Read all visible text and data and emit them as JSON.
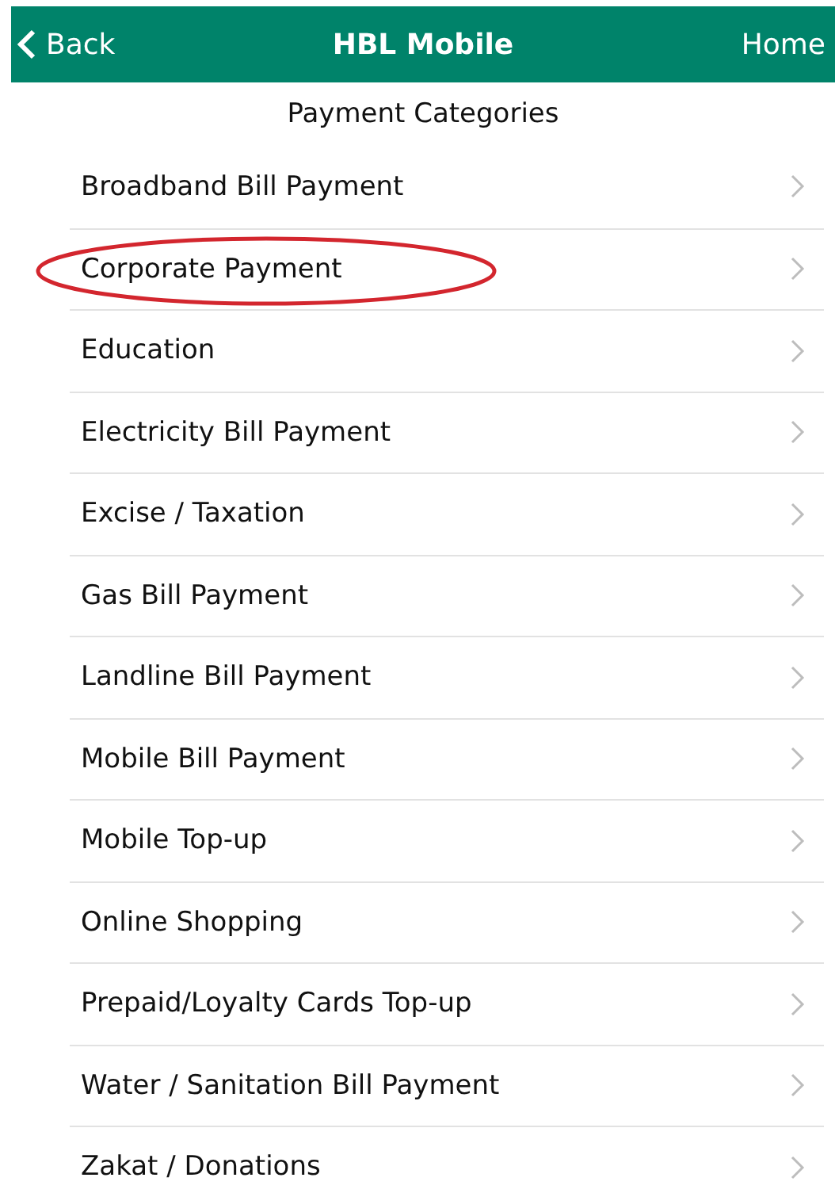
{
  "nav_bar": {
    "back": "Back",
    "title": "HBL Mobile",
    "home": "Home"
  },
  "section_title": "Payment Categories",
  "categories": [
    {
      "label": "Broadband Bill Payment",
      "circled": false
    },
    {
      "label": "Corporate Payment",
      "circled": true
    },
    {
      "label": "Education",
      "circled": false
    },
    {
      "label": "Electricity Bill Payment",
      "circled": false
    },
    {
      "label": "Excise / Taxation",
      "circled": false
    },
    {
      "label": "Gas Bill Payment",
      "circled": false
    },
    {
      "label": "Landline Bill Payment",
      "circled": false
    },
    {
      "label": "Mobile Bill Payment",
      "circled": false
    },
    {
      "label": "Mobile Top-up",
      "circled": false
    },
    {
      "label": "Online Shopping",
      "circled": false
    },
    {
      "label": "Prepaid/Loyalty Cards Top-up",
      "circled": false
    },
    {
      "label": "Water / Sanitation Bill Payment",
      "circled": false
    },
    {
      "label": "Zakat / Donations",
      "circled": false
    }
  ]
}
